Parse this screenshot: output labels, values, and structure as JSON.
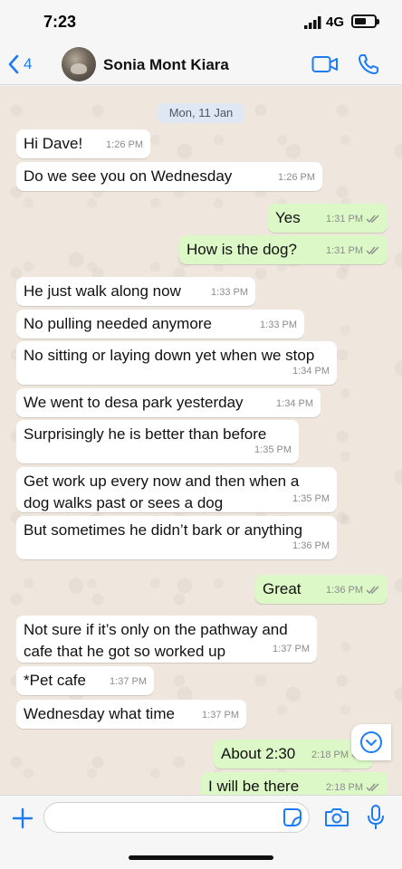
{
  "status": {
    "time": "7:23",
    "network": "4G"
  },
  "header": {
    "back_count": "4",
    "contact_name": "Sonia Mont Kiara"
  },
  "chat": {
    "date": "Mon, 11 Jan",
    "messages": [
      {
        "dir": "in",
        "text": "Hi Dave!",
        "time": "1:26 PM"
      },
      {
        "dir": "in",
        "text": "Do we see you on Wednesday",
        "time": "1:26 PM"
      },
      {
        "dir": "out",
        "text": "Yes",
        "time": "1:31 PM"
      },
      {
        "dir": "out",
        "text": "How is the dog?",
        "time": "1:31 PM"
      },
      {
        "dir": "in",
        "text": "He just walk along now",
        "time": "1:33 PM"
      },
      {
        "dir": "in",
        "text": "No pulling needed anymore",
        "time": "1:33 PM"
      },
      {
        "dir": "in",
        "text": "No sitting or laying down yet when we stop",
        "time": "1:34 PM"
      },
      {
        "dir": "in",
        "text": "We went to desa park yesterday",
        "time": "1:34 PM"
      },
      {
        "dir": "in",
        "text": "Surprisingly he is better than before",
        "time": "1:35 PM"
      },
      {
        "dir": "in",
        "text": "Get work up every now and then when a",
        "text2": "dog walks past or sees a dog",
        "time": "1:35 PM"
      },
      {
        "dir": "in",
        "text": "But sometimes he didn’t bark or anything",
        "time": "1:36 PM"
      },
      {
        "dir": "out",
        "text": "Great",
        "time": "1:36 PM"
      },
      {
        "dir": "in",
        "text": "Not sure if it’s only on the pathway and",
        "text2": "cafe that he got so worked up",
        "time": "1:37 PM"
      },
      {
        "dir": "in",
        "text": "*Pet cafe",
        "time": "1:37 PM"
      },
      {
        "dir": "in",
        "text": "Wednesday what time",
        "time": "1:37 PM"
      },
      {
        "dir": "out",
        "text": "About 2:30",
        "time": "2:18 PM"
      },
      {
        "dir": "out",
        "text": "I will be there",
        "time": "2:18 PM"
      }
    ]
  },
  "input": {
    "placeholder": ""
  },
  "colors": {
    "accent": "#1c7cf4",
    "tick": "#53bdeb",
    "outgoing": "#dcf8c6",
    "incoming": "#ffffff"
  }
}
